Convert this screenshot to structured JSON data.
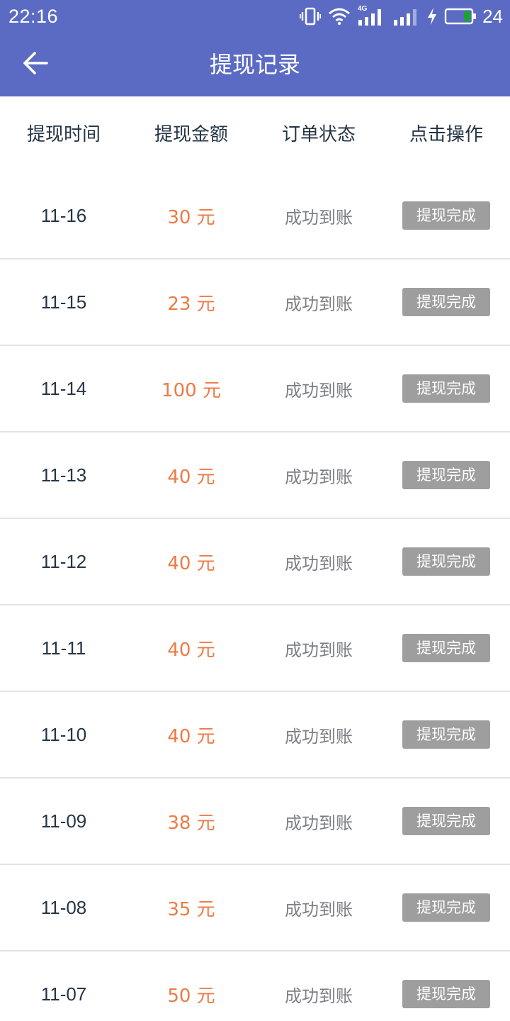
{
  "status_bar": {
    "time": "22:16",
    "network_label": "4G",
    "battery_level": "24",
    "icons": [
      "vibrate-icon",
      "wifi-icon",
      "signal-4g-icon",
      "signal-icon",
      "charging-icon",
      "battery-icon"
    ],
    "battery_color": "#1aa52b"
  },
  "app_bar": {
    "title": "提现记录",
    "back_icon": "arrow-left-icon",
    "background": "#5b6bc3"
  },
  "table": {
    "headers": [
      "提现时间",
      "提现金额",
      "订单状态",
      "点击操作"
    ],
    "rows": [
      {
        "date": "11-16",
        "amount": "30 元",
        "status": "成功到账",
        "action": "提现完成"
      },
      {
        "date": "11-15",
        "amount": "23 元",
        "status": "成功到账",
        "action": "提现完成"
      },
      {
        "date": "11-14",
        "amount": "100 元",
        "status": "成功到账",
        "action": "提现完成"
      },
      {
        "date": "11-13",
        "amount": "40 元",
        "status": "成功到账",
        "action": "提现完成"
      },
      {
        "date": "11-12",
        "amount": "40 元",
        "status": "成功到账",
        "action": "提现完成"
      },
      {
        "date": "11-11",
        "amount": "40 元",
        "status": "成功到账",
        "action": "提现完成"
      },
      {
        "date": "11-10",
        "amount": "40 元",
        "status": "成功到账",
        "action": "提现完成"
      },
      {
        "date": "11-09",
        "amount": "38 元",
        "status": "成功到账",
        "action": "提现完成"
      },
      {
        "date": "11-08",
        "amount": "35 元",
        "status": "成功到账",
        "action": "提现完成"
      },
      {
        "date": "11-07",
        "amount": "50 元",
        "status": "成功到账",
        "action": "提现完成"
      }
    ]
  },
  "colors": {
    "amount": "#ec7b46",
    "status": "#7c7f85",
    "button": "#9e9e9e",
    "header_text": "#263545"
  }
}
